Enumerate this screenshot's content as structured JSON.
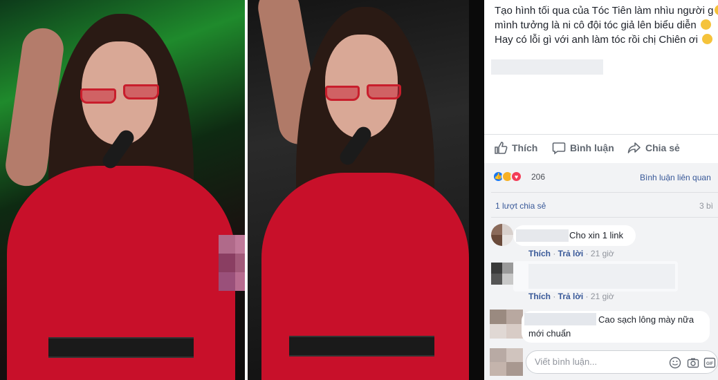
{
  "post": {
    "lines": [
      "Tạo hình tối qua của Tóc Tiên làm nhìu người g",
      "mình tưởng là ni cô đội tóc giả lên biểu diễn",
      "Hay có lỗi gì với anh làm tóc rồi chị Chiên ơi"
    ]
  },
  "actions": {
    "like": "Thích",
    "comment": "Bình luận",
    "share": "Chia sẻ"
  },
  "reactions": {
    "count": "206",
    "types": [
      "like-icon",
      "haha-icon",
      "love-icon"
    ]
  },
  "related_link": "Bình luận liên quan",
  "shares_text": "1 lượt chia sẻ",
  "comments_count": "3 bì",
  "comments": [
    {
      "text": "Cho xin 1 link",
      "like": "Thích",
      "reply": "Trả lời",
      "time": "21 giờ"
    },
    {
      "text": "",
      "like": "Thích",
      "reply": "Trả lời",
      "time": "21 giờ"
    },
    {
      "text_line1": "Cao sạch lông mày nữa",
      "text_line2": "mới chuẩn"
    }
  ],
  "composer": {
    "placeholder": "Viết bình luận..."
  },
  "colors": {
    "link": "#385898",
    "text": "#1d2129",
    "muted": "#90949c",
    "like_blue": "#1877f2",
    "love_red": "#f33e58",
    "haha_yellow": "#f7b125",
    "outfit_red": "#c8102a"
  }
}
